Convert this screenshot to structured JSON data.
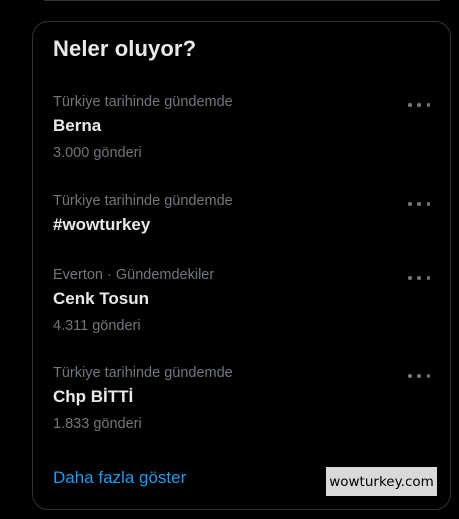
{
  "panel": {
    "title": "Neler oluyor?",
    "show_more_label": "Daha fazla göster",
    "more_icon": "ellipsis-icon"
  },
  "trends": [
    {
      "context": "Türkiye tarihinde gündemde",
      "name": "Berna",
      "count": "3.000 gönderi"
    },
    {
      "context": "Türkiye tarihinde gündemde",
      "name": "#wowturkey",
      "count": ""
    },
    {
      "context": "Everton · Gündemdekiler",
      "name": "Cenk Tosun",
      "count": "4.311 gönderi"
    },
    {
      "context": "Türkiye tarihinde gündemde",
      "name": "Chp BİTTİ",
      "count": "1.833 gönderi"
    }
  ],
  "watermark": "wowturkey.com",
  "colors": {
    "background": "#000000",
    "border": "#2f3336",
    "primary_text": "#e7e9ea",
    "secondary_text": "#71767b",
    "link": "#1d9bf0"
  }
}
